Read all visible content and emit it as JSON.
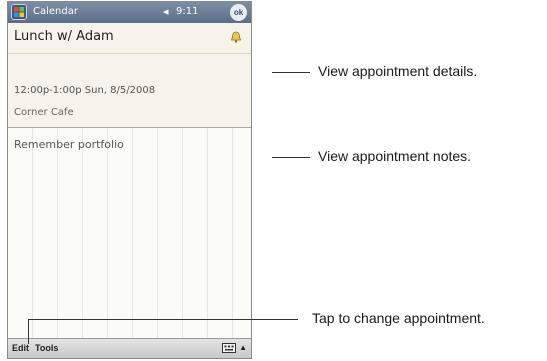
{
  "titlebar": {
    "app_title": "Calendar",
    "time": "9:11",
    "ok_label": "ok",
    "start_icon": "windows-flag-icon",
    "volume_icon": "speaker-icon"
  },
  "appointment": {
    "subject": "Lunch w/ Adam",
    "when": "12:00p-1:00p Sun, 8/5/2008",
    "location": "Corner Cafe",
    "notes": "Remember portfolio"
  },
  "menubar": {
    "edit_label": "Edit",
    "tools_label": "Tools"
  },
  "callouts": {
    "details": "View appointment details.",
    "notes": "View appointment notes.",
    "edit": "Tap to change appointment."
  }
}
